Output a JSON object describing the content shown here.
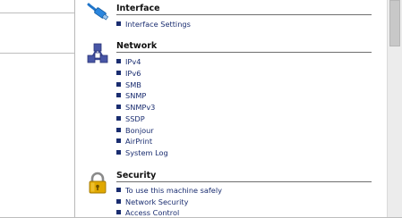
{
  "sections": {
    "interface": {
      "title": "Interface",
      "icon": "ethernet-cable-icon",
      "items": [
        "Interface Settings"
      ]
    },
    "network": {
      "title": "Network",
      "icon": "network-nodes-icon",
      "items": [
        "IPv4",
        "IPv6",
        "SMB",
        "SNMP",
        "SNMPv3",
        "SSDP",
        "Bonjour",
        "AirPrint",
        "System Log"
      ]
    },
    "security": {
      "title": "Security",
      "icon": "padlock-icon",
      "items": [
        "To use this machine safely",
        "Network Security",
        "Access Control"
      ]
    }
  },
  "colors": {
    "link": "#1a2d70",
    "heading": "#111111",
    "network_icon": "#3d4a9a",
    "cable_icon": "#1f74c9",
    "lock_icon": "#e0a800"
  }
}
